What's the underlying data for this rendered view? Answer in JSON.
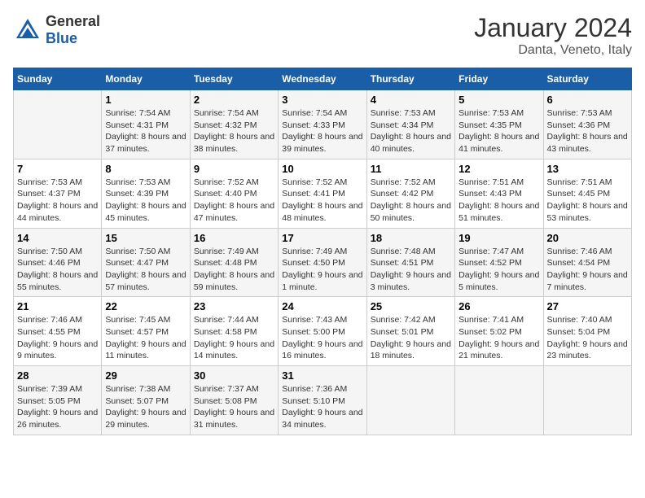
{
  "header": {
    "logo_general": "General",
    "logo_blue": "Blue",
    "title": "January 2024",
    "subtitle": "Danta, Veneto, Italy"
  },
  "weekdays": [
    "Sunday",
    "Monday",
    "Tuesday",
    "Wednesday",
    "Thursday",
    "Friday",
    "Saturday"
  ],
  "weeks": [
    [
      {
        "day": "",
        "sunrise": "",
        "sunset": "",
        "daylight": ""
      },
      {
        "day": "1",
        "sunrise": "Sunrise: 7:54 AM",
        "sunset": "Sunset: 4:31 PM",
        "daylight": "Daylight: 8 hours and 37 minutes."
      },
      {
        "day": "2",
        "sunrise": "Sunrise: 7:54 AM",
        "sunset": "Sunset: 4:32 PM",
        "daylight": "Daylight: 8 hours and 38 minutes."
      },
      {
        "day": "3",
        "sunrise": "Sunrise: 7:54 AM",
        "sunset": "Sunset: 4:33 PM",
        "daylight": "Daylight: 8 hours and 39 minutes."
      },
      {
        "day": "4",
        "sunrise": "Sunrise: 7:53 AM",
        "sunset": "Sunset: 4:34 PM",
        "daylight": "Daylight: 8 hours and 40 minutes."
      },
      {
        "day": "5",
        "sunrise": "Sunrise: 7:53 AM",
        "sunset": "Sunset: 4:35 PM",
        "daylight": "Daylight: 8 hours and 41 minutes."
      },
      {
        "day": "6",
        "sunrise": "Sunrise: 7:53 AM",
        "sunset": "Sunset: 4:36 PM",
        "daylight": "Daylight: 8 hours and 43 minutes."
      }
    ],
    [
      {
        "day": "7",
        "sunrise": "Sunrise: 7:53 AM",
        "sunset": "Sunset: 4:37 PM",
        "daylight": "Daylight: 8 hours and 44 minutes."
      },
      {
        "day": "8",
        "sunrise": "Sunrise: 7:53 AM",
        "sunset": "Sunset: 4:39 PM",
        "daylight": "Daylight: 8 hours and 45 minutes."
      },
      {
        "day": "9",
        "sunrise": "Sunrise: 7:52 AM",
        "sunset": "Sunset: 4:40 PM",
        "daylight": "Daylight: 8 hours and 47 minutes."
      },
      {
        "day": "10",
        "sunrise": "Sunrise: 7:52 AM",
        "sunset": "Sunset: 4:41 PM",
        "daylight": "Daylight: 8 hours and 48 minutes."
      },
      {
        "day": "11",
        "sunrise": "Sunrise: 7:52 AM",
        "sunset": "Sunset: 4:42 PM",
        "daylight": "Daylight: 8 hours and 50 minutes."
      },
      {
        "day": "12",
        "sunrise": "Sunrise: 7:51 AM",
        "sunset": "Sunset: 4:43 PM",
        "daylight": "Daylight: 8 hours and 51 minutes."
      },
      {
        "day": "13",
        "sunrise": "Sunrise: 7:51 AM",
        "sunset": "Sunset: 4:45 PM",
        "daylight": "Daylight: 8 hours and 53 minutes."
      }
    ],
    [
      {
        "day": "14",
        "sunrise": "Sunrise: 7:50 AM",
        "sunset": "Sunset: 4:46 PM",
        "daylight": "Daylight: 8 hours and 55 minutes."
      },
      {
        "day": "15",
        "sunrise": "Sunrise: 7:50 AM",
        "sunset": "Sunset: 4:47 PM",
        "daylight": "Daylight: 8 hours and 57 minutes."
      },
      {
        "day": "16",
        "sunrise": "Sunrise: 7:49 AM",
        "sunset": "Sunset: 4:48 PM",
        "daylight": "Daylight: 8 hours and 59 minutes."
      },
      {
        "day": "17",
        "sunrise": "Sunrise: 7:49 AM",
        "sunset": "Sunset: 4:50 PM",
        "daylight": "Daylight: 9 hours and 1 minute."
      },
      {
        "day": "18",
        "sunrise": "Sunrise: 7:48 AM",
        "sunset": "Sunset: 4:51 PM",
        "daylight": "Daylight: 9 hours and 3 minutes."
      },
      {
        "day": "19",
        "sunrise": "Sunrise: 7:47 AM",
        "sunset": "Sunset: 4:52 PM",
        "daylight": "Daylight: 9 hours and 5 minutes."
      },
      {
        "day": "20",
        "sunrise": "Sunrise: 7:46 AM",
        "sunset": "Sunset: 4:54 PM",
        "daylight": "Daylight: 9 hours and 7 minutes."
      }
    ],
    [
      {
        "day": "21",
        "sunrise": "Sunrise: 7:46 AM",
        "sunset": "Sunset: 4:55 PM",
        "daylight": "Daylight: 9 hours and 9 minutes."
      },
      {
        "day": "22",
        "sunrise": "Sunrise: 7:45 AM",
        "sunset": "Sunset: 4:57 PM",
        "daylight": "Daylight: 9 hours and 11 minutes."
      },
      {
        "day": "23",
        "sunrise": "Sunrise: 7:44 AM",
        "sunset": "Sunset: 4:58 PM",
        "daylight": "Daylight: 9 hours and 14 minutes."
      },
      {
        "day": "24",
        "sunrise": "Sunrise: 7:43 AM",
        "sunset": "Sunset: 5:00 PM",
        "daylight": "Daylight: 9 hours and 16 minutes."
      },
      {
        "day": "25",
        "sunrise": "Sunrise: 7:42 AM",
        "sunset": "Sunset: 5:01 PM",
        "daylight": "Daylight: 9 hours and 18 minutes."
      },
      {
        "day": "26",
        "sunrise": "Sunrise: 7:41 AM",
        "sunset": "Sunset: 5:02 PM",
        "daylight": "Daylight: 9 hours and 21 minutes."
      },
      {
        "day": "27",
        "sunrise": "Sunrise: 7:40 AM",
        "sunset": "Sunset: 5:04 PM",
        "daylight": "Daylight: 9 hours and 23 minutes."
      }
    ],
    [
      {
        "day": "28",
        "sunrise": "Sunrise: 7:39 AM",
        "sunset": "Sunset: 5:05 PM",
        "daylight": "Daylight: 9 hours and 26 minutes."
      },
      {
        "day": "29",
        "sunrise": "Sunrise: 7:38 AM",
        "sunset": "Sunset: 5:07 PM",
        "daylight": "Daylight: 9 hours and 29 minutes."
      },
      {
        "day": "30",
        "sunrise": "Sunrise: 7:37 AM",
        "sunset": "Sunset: 5:08 PM",
        "daylight": "Daylight: 9 hours and 31 minutes."
      },
      {
        "day": "31",
        "sunrise": "Sunrise: 7:36 AM",
        "sunset": "Sunset: 5:10 PM",
        "daylight": "Daylight: 9 hours and 34 minutes."
      },
      {
        "day": "",
        "sunrise": "",
        "sunset": "",
        "daylight": ""
      },
      {
        "day": "",
        "sunrise": "",
        "sunset": "",
        "daylight": ""
      },
      {
        "day": "",
        "sunrise": "",
        "sunset": "",
        "daylight": ""
      }
    ]
  ]
}
